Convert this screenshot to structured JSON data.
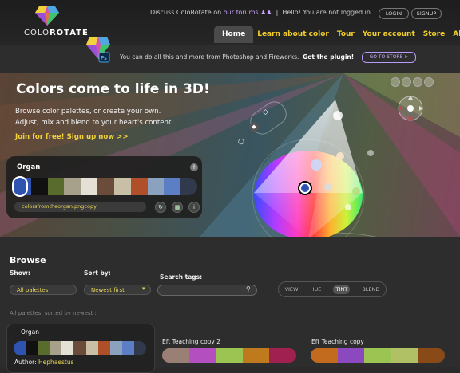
{
  "header": {
    "logo_prefix": "COLO",
    "logo_suffix": "ROTATE",
    "discuss": "Discuss ",
    "app_name": "ColoRotate",
    "on": " on ",
    "forums": "our forums",
    "hello": "Hello! You are not logged in.",
    "login": "LOGIN",
    "signup": "SIGNUP",
    "nav": [
      "Home",
      "Learn about color",
      "Tour",
      "Your account",
      "Store",
      "About"
    ]
  },
  "plugin": {
    "text": "You can do all this and more from Photoshop and Fireworks.",
    "cta": "Get the plugin!",
    "store": "GO TO STORE"
  },
  "hero": {
    "title": "Colors come to life in 3D!",
    "sub1": "Browse color palettes, or create your own.",
    "sub2": "Adjust, mix and blend to your heart's content.",
    "join": "Join for free! Sign up now >>"
  },
  "palette": {
    "name": "Organ",
    "add_icon": "+",
    "file": "colorsfromtheorgan.pngcopy",
    "colors": [
      "#2f53b0",
      "#111111",
      "#5a6b2e",
      "#a7a08a",
      "#e4e0d6",
      "#6b4b3a",
      "#c9bfa6",
      "#b0502a",
      "#8aa2be",
      "#5b7ec4",
      "#313a4d"
    ]
  },
  "browse": {
    "title": "Browse",
    "show_label": "Show:",
    "show_value": "All palettes",
    "sort_label": "Sort by:",
    "sort_value": "Newest first",
    "search_label": "Search tags:",
    "modes": [
      "VIEW",
      "HUE",
      "TINT",
      "BLEND"
    ],
    "active_mode": "TINT",
    "sorted_note": "All palettes, sorted by newest :"
  },
  "cards": [
    {
      "title": "Organ",
      "author_label": "Author:",
      "author": "Hephaestus",
      "colors": [
        "#2f53b0",
        "#111111",
        "#5a6b2e",
        "#a7a08a",
        "#e4e0d6",
        "#6b4b3a",
        "#c9bfa6",
        "#b0502a",
        "#8aa2be",
        "#5b7ec4",
        "#313a4d"
      ]
    },
    {
      "title": "Eft Teaching copy 2",
      "colors": [
        "#9a7f74",
        "#b34fbf",
        "#9bc452",
        "#c07a1e",
        "#a0204f"
      ]
    },
    {
      "title": "Eft Teaching copy",
      "colors": [
        "#c26a1e",
        "#8c49bf",
        "#9bc452",
        "#b0c065",
        "#8a4a18"
      ]
    }
  ]
}
